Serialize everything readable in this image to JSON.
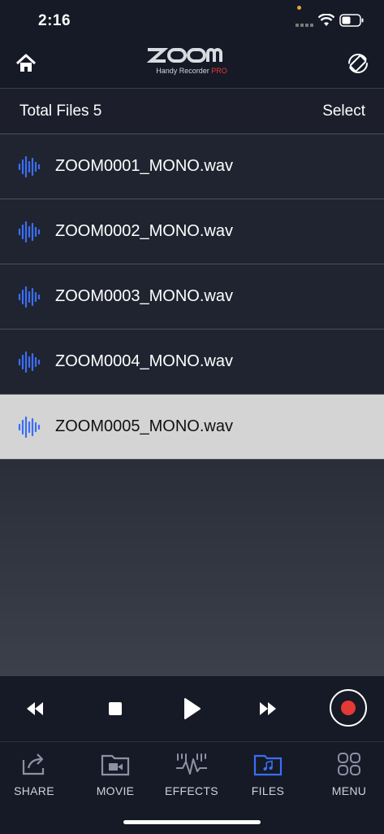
{
  "status": {
    "time": "2:16"
  },
  "header": {
    "logo_text": "ZOOM",
    "logo_sub": "Handy Recorder",
    "logo_pro": "PRO"
  },
  "summary": {
    "total_label": "Total Files 5",
    "select_label": "Select"
  },
  "files": [
    {
      "name": "ZOOM0001_MONO.wav"
    },
    {
      "name": "ZOOM0002_MONO.wav"
    },
    {
      "name": "ZOOM0003_MONO.wav"
    },
    {
      "name": "ZOOM0004_MONO.wav"
    },
    {
      "name": "ZOOM0005_MONO.wav"
    }
  ],
  "tabs": [
    {
      "label": "SHARE",
      "icon": "share-icon"
    },
    {
      "label": "MOVIE",
      "icon": "movie-icon"
    },
    {
      "label": "EFFECTS",
      "icon": "effects-icon"
    },
    {
      "label": "FILES",
      "icon": "files-icon"
    },
    {
      "label": "MENU",
      "icon": "menu-icon"
    }
  ],
  "colors": {
    "accent": "#3b6ef5",
    "record": "#e53935",
    "selected_row": "#d4d4d4"
  }
}
